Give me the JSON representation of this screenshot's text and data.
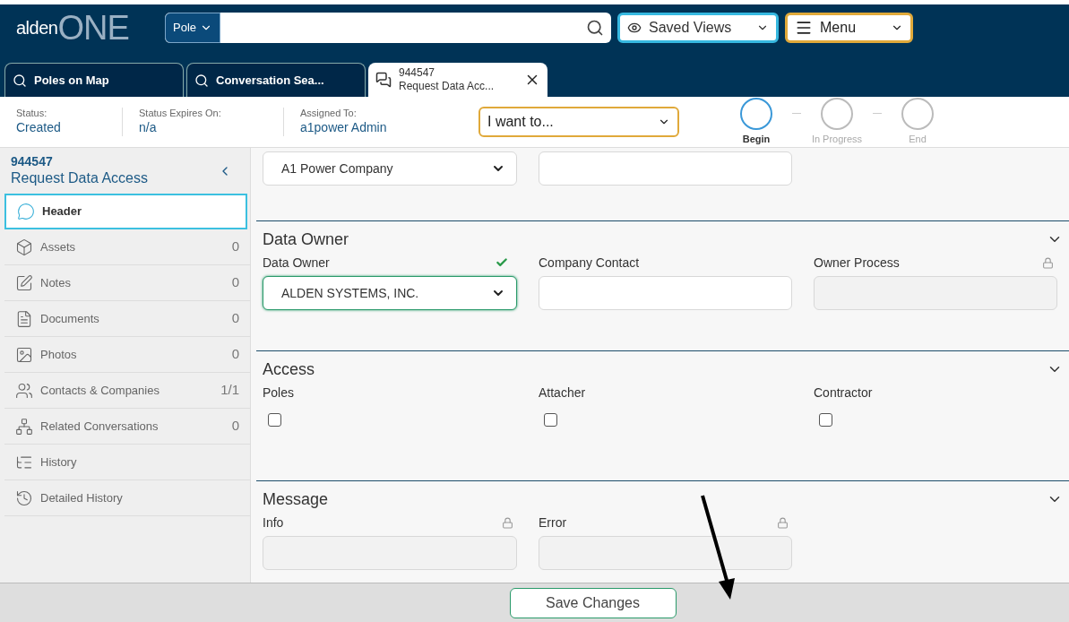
{
  "logo": {
    "prefix": "alden",
    "suffix": "ONE"
  },
  "search": {
    "scope": "Pole"
  },
  "saved_views": {
    "label": "Saved Views"
  },
  "menu": {
    "label": "Menu"
  },
  "tabs": [
    {
      "kind": "search",
      "label": "Poles on Map",
      "selected": false
    },
    {
      "kind": "search",
      "label": "Conversation Sea...",
      "selected": false
    },
    {
      "kind": "conversation",
      "number": "944547",
      "label": "Request Data Acc...",
      "selected": true
    }
  ],
  "status": [
    {
      "label": "Status:",
      "value": "Created"
    },
    {
      "label": "Status Expires On:",
      "value": "n/a"
    },
    {
      "label": "Assigned To:",
      "value": "a1power Admin"
    }
  ],
  "action_select": {
    "value": "I want to..."
  },
  "steps": [
    {
      "label": "Begin",
      "selected": true
    },
    {
      "label": "In Progress",
      "selected": false
    },
    {
      "label": "End",
      "selected": false
    }
  ],
  "sidebar": {
    "number": "944547",
    "title": "Request Data Access",
    "items": [
      {
        "kind": "chat",
        "label": "Header",
        "selected": true
      },
      {
        "kind": "box",
        "label": "Assets",
        "count": "0",
        "selected": false
      },
      {
        "kind": "note",
        "label": "Notes",
        "count": "0",
        "selected": false
      },
      {
        "kind": "document",
        "label": "Documents",
        "count": "0",
        "selected": false
      },
      {
        "kind": "photo",
        "label": "Photos",
        "count": "0",
        "selected": false
      },
      {
        "kind": "contacts",
        "label": "Contacts & Companies",
        "count": "1/1",
        "selected": false
      },
      {
        "kind": "network",
        "label": "Related Conversations",
        "count": "0",
        "selected": false
      },
      {
        "kind": "history",
        "label": "History",
        "selected": false
      },
      {
        "kind": "detailed",
        "label": "Detailed History",
        "selected": false
      }
    ]
  },
  "sections": [
    {
      "fields": [
        {
          "kind": "select",
          "value": "A1 Power Company",
          "valid": false,
          "locked": false
        },
        {
          "kind": "text",
          "valid": false,
          "locked": false
        }
      ]
    },
    {
      "title": "Data Owner",
      "fields": [
        {
          "kind": "select",
          "label": "Data Owner",
          "value": "ALDEN SYSTEMS, INC.",
          "valid": true,
          "locked": false
        },
        {
          "kind": "text",
          "label": "Company Contact",
          "valid": false,
          "locked": false
        },
        {
          "kind": "text",
          "label": "Owner Process",
          "valid": false,
          "locked": true
        }
      ]
    },
    {
      "title": "Access",
      "fields": [
        {
          "kind": "checkbox",
          "label": "Poles",
          "checked": false
        },
        {
          "kind": "checkbox",
          "label": "Attacher",
          "checked": false
        },
        {
          "kind": "checkbox",
          "label": "Contractor",
          "checked": false
        }
      ]
    },
    {
      "title": "Message",
      "fields": [
        {
          "kind": "text",
          "label": "Info",
          "valid": false,
          "locked": true
        },
        {
          "kind": "text",
          "label": "Error",
          "valid": false,
          "locked": true
        }
      ]
    }
  ],
  "footer": {
    "save": "Save Changes"
  }
}
